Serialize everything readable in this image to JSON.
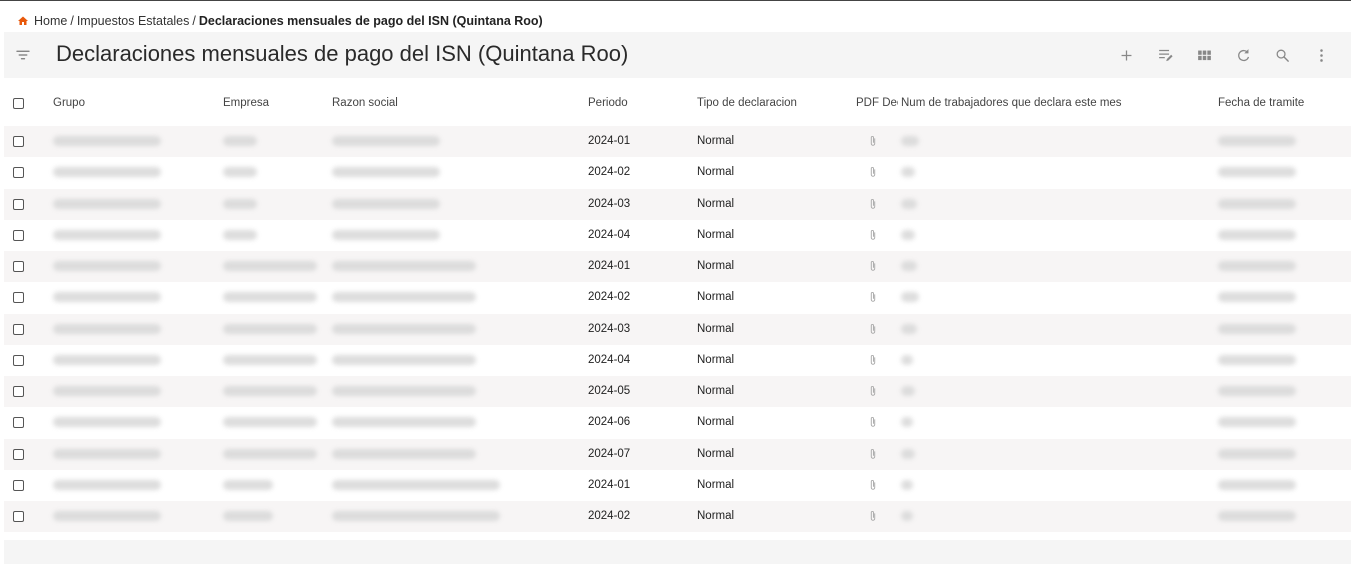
{
  "breadcrumb": {
    "home": "Home",
    "sep1": "/",
    "section": "Impuestos Estatales",
    "sep2": "/",
    "current": "Declaraciones mensuales de pago del ISN (Quintana Roo)"
  },
  "toolbar": {
    "title": "Declaraciones mensuales de pago del ISN (Quintana Roo)",
    "icons": [
      "filter-icon",
      "add-icon",
      "edit-columns-icon",
      "grid-icon",
      "refresh-icon",
      "search-icon",
      "more-vert-icon"
    ]
  },
  "colors": {
    "accent": "#e8590c",
    "toolbar_bg": "#f5f5f5",
    "stripe": "#f7f5f5"
  },
  "table": {
    "columns": {
      "grupo": "Grupo",
      "empresa": "Empresa",
      "razon": "Razon social",
      "periodo": "Periodo",
      "tipo": "Tipo de declaracion",
      "pdf": "PDF Dec",
      "num": "Num de trabajadores que declara este mes",
      "fecha": "Fecha de tramite"
    },
    "rows": [
      {
        "periodo": "2024-01",
        "tipo": "Normal"
      },
      {
        "periodo": "2024-02",
        "tipo": "Normal"
      },
      {
        "periodo": "2024-03",
        "tipo": "Normal"
      },
      {
        "periodo": "2024-04",
        "tipo": "Normal"
      },
      {
        "periodo": "2024-01",
        "tipo": "Normal"
      },
      {
        "periodo": "2024-02",
        "tipo": "Normal"
      },
      {
        "periodo": "2024-03",
        "tipo": "Normal"
      },
      {
        "periodo": "2024-04",
        "tipo": "Normal"
      },
      {
        "periodo": "2024-05",
        "tipo": "Normal"
      },
      {
        "periodo": "2024-06",
        "tipo": "Normal"
      },
      {
        "periodo": "2024-07",
        "tipo": "Normal"
      },
      {
        "periodo": "2024-01",
        "tipo": "Normal"
      },
      {
        "periodo": "2024-02",
        "tipo": "Normal"
      }
    ]
  }
}
